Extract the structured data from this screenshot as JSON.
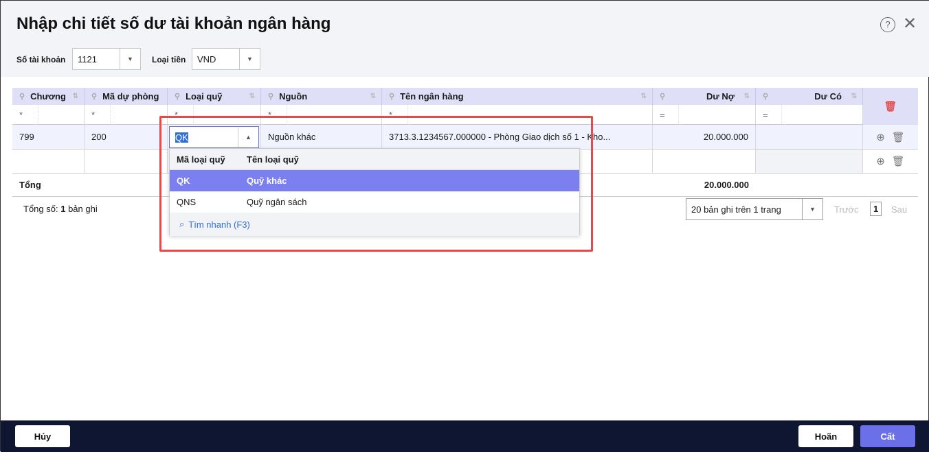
{
  "title": "Nhập chi tiết số dư tài khoản ngân hàng",
  "filters": {
    "account_label": "Số tài khoản",
    "account_value": "1121",
    "currency_label": "Loại tiền",
    "currency_value": "VND"
  },
  "columns": [
    "Chương",
    "Mã dự phòng",
    "Loại quỹ",
    "Nguồn",
    "Tên ngân hàng",
    "Dư Nợ",
    "Dư Có"
  ],
  "filter_ops": [
    "*",
    "*",
    "*",
    "*",
    "*",
    "=",
    "="
  ],
  "row": {
    "chuong": "799",
    "ma_du_phong": "200",
    "loai_quy": "QK",
    "nguon": "Nguồn khác",
    "ten_ngan_hang": "3713.3.1234567.000000 - Phòng Giao dịch số 1 - Kho...",
    "du_no": "20.000.000",
    "du_co": ""
  },
  "total": {
    "label": "Tổng",
    "du_no": "20.000.000"
  },
  "summary": {
    "prefix": "Tổng số:",
    "count": "1",
    "suffix": "bản ghi"
  },
  "pager": {
    "page_size": "20 bản ghi trên 1 trang",
    "prev": "Trước",
    "page": "1",
    "next": "Sau"
  },
  "dropdown": {
    "headers": [
      "Mã loại quỹ",
      "Tên loại quỹ"
    ],
    "items": [
      {
        "code": "QK",
        "name": "Quỹ khác"
      },
      {
        "code": "QNS",
        "name": "Quỹ ngân sách"
      }
    ],
    "quick_search": "Tìm nhanh (F3)"
  },
  "footer": {
    "cancel": "Hủy",
    "undo": "Hoãn",
    "save": "Cất"
  },
  "colors": {
    "accent": "#7b7ff0",
    "header": "#dfe0f8",
    "footer": "#0f1631"
  }
}
